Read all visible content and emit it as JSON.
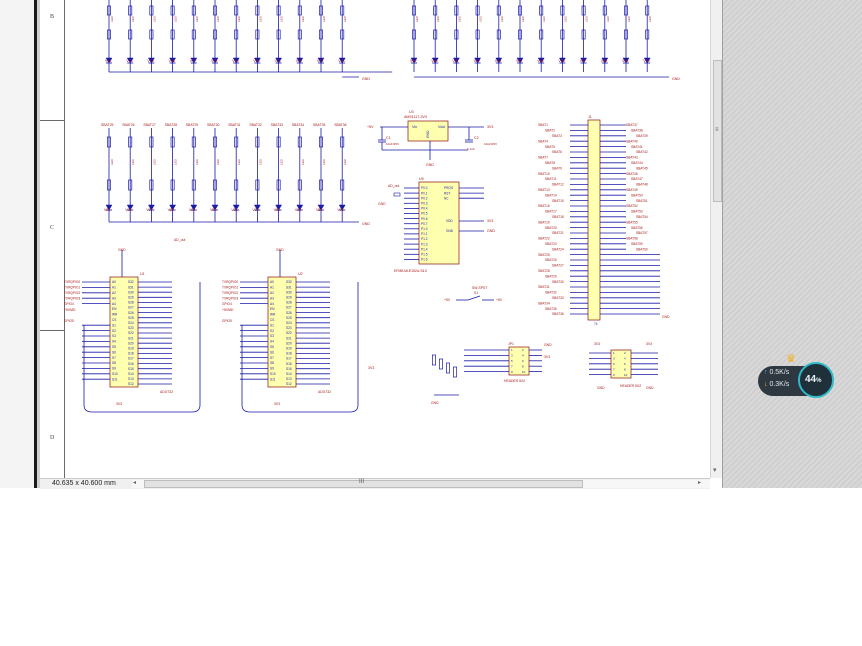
{
  "status": {
    "coordinates": "40.635 x 40.600 ",
    "unit": "mm"
  },
  "zones": [
    "B",
    "C",
    "D"
  ],
  "schematic": {
    "leds_row1_top": [
      "V13",
      "V14",
      "V15",
      "V16",
      "V17",
      "V18",
      "V19",
      "V20",
      "V21",
      "V22",
      "V23",
      "V24"
    ],
    "leds_row1_right": [
      "V49",
      "V50",
      "V51",
      "V52",
      "V53",
      "V54",
      "V55",
      "V56",
      "V57",
      "V58",
      "V59",
      "V60"
    ],
    "leds_row2_top": [
      "SBAT25",
      "SBAT26",
      "SBAT27",
      "SBAT28",
      "SBAT29",
      "SBAT30",
      "SBAT31",
      "SBAT32",
      "SBAT33",
      "SBAT34",
      "SBAT35",
      "SBAT36"
    ],
    "leds_row2_bottom": [
      "V25",
      "V26",
      "V27",
      "V28",
      "V29",
      "V30",
      "V31",
      "V32",
      "V33",
      "V34",
      "V35",
      "V36"
    ],
    "gnd": "GND",
    "regulator": {
      "ref": "U3",
      "part": "AMS1117-3V3",
      "vin": "Vin",
      "vout": "Vout",
      "gnd": "GND"
    },
    "caps": {
      "c1": "C1",
      "c1_val": "10uF/25V",
      "c2": "C2",
      "c2_val": "10uF/25V",
      "c3_val": "0.1uF",
      "v5": "+5V",
      "v33": "3V3"
    },
    "mcu": {
      "ref": "U9",
      "part": "EFM8BB10F8G-A-SOIC16 ... SI8-MLE15A-S4.0"
    },
    "mcu_label": "EFM8-MLE152A-S4.0",
    "mcu_pins_left": [
      "P0.0",
      "P0.1",
      "P0.2",
      "P0.3",
      "P0.4",
      "P0.5",
      "P0.6",
      "P0.7",
      "P1.0",
      "P1.1",
      "P1.2",
      "P1.3",
      "P1.4",
      "P1.5",
      "P1.6"
    ],
    "mcu_pins_right": [
      "PROG",
      "RST",
      "NC",
      "VDD",
      "GND"
    ],
    "connector": {
      "ref": "J1",
      "part": ""
    },
    "conn_left": [
      "SBAT1",
      "SBAT2",
      "SBAT3",
      "SBAT4",
      "SBAT5",
      "SBAT6",
      "SBAT7",
      "SBAT8",
      "SBAT9",
      "SBAT10",
      "SBAT11",
      "SBAT12",
      "SBAT13",
      "SBAT14",
      "SBAT15",
      "SBAT16",
      "SBAT17",
      "SBAT18",
      "SBAT19",
      "SBAT20",
      "SBAT21",
      "SBAT22",
      "SBAT23",
      "SBAT24",
      "SBAT25",
      "SBAT26",
      "SBAT27",
      "SBAT28",
      "SBAT29",
      "SBAT30",
      "SBAT31",
      "SBAT32",
      "SBAT33",
      "SBAT34",
      "SBAT35",
      "SBAT36"
    ],
    "conn_right": [
      "SBAT37",
      "SBAT38",
      "SBAT39",
      "SBAT40",
      "SBAT41",
      "SBAT42",
      "SBAT43",
      "SBAT44",
      "SBAT45",
      "SBAT46",
      "SBAT47",
      "SBAT48",
      "SBAT49",
      "SBAT50",
      "SBAT51",
      "SBAT52",
      "SBAT53",
      "SBAT54",
      "SBAT55",
      "SBAT56",
      "SBAT57",
      "SBAT58",
      "SBAT59",
      "SBAT60"
    ],
    "adc_left": {
      "ref": "U1",
      "part": "ADG732",
      "net": "AD_out"
    },
    "adc_right": {
      "ref": "U2",
      "part": "ADG732"
    },
    "adc_inputs": [
      "TXRQPIO0",
      "TXRQPIO1",
      "TXRQPIO2",
      "TXRQPIO3",
      "GPIO4"
    ],
    "adc_mux_pins": [
      "A0",
      "A1",
      "A2",
      "A3",
      "A4",
      "EN",
      "WR",
      "CS",
      "S1",
      "S2",
      "S3",
      "S4",
      "S5",
      "S6",
      "S7",
      "S8",
      "S9",
      "S10",
      "S11"
    ],
    "adc_out_pins": [
      "S32",
      "S31",
      "S30",
      "S29",
      "S28",
      "S27",
      "S26",
      "S25",
      "S24",
      "S23",
      "S22",
      "S21",
      "S20",
      "S19",
      "S18",
      "S17",
      "S16",
      "S15",
      "S14",
      "S13",
      "S12"
    ],
    "header5x2_a": {
      "ref": "JP1",
      "part": "HEADER 5X2"
    },
    "header5x2_b": {
      "ref": "JP2",
      "part": "HEADER 5X2"
    },
    "switch": {
      "ref": "S1",
      "part": "SW-SPST",
      "plus": "+5V"
    },
    "v3_net": "3V3",
    "vmd_net": "+5VMD"
  },
  "net_widget": {
    "up": "0.5K/s",
    "down": "0.3K/s",
    "percent": "44",
    "percent_sign": "%"
  }
}
